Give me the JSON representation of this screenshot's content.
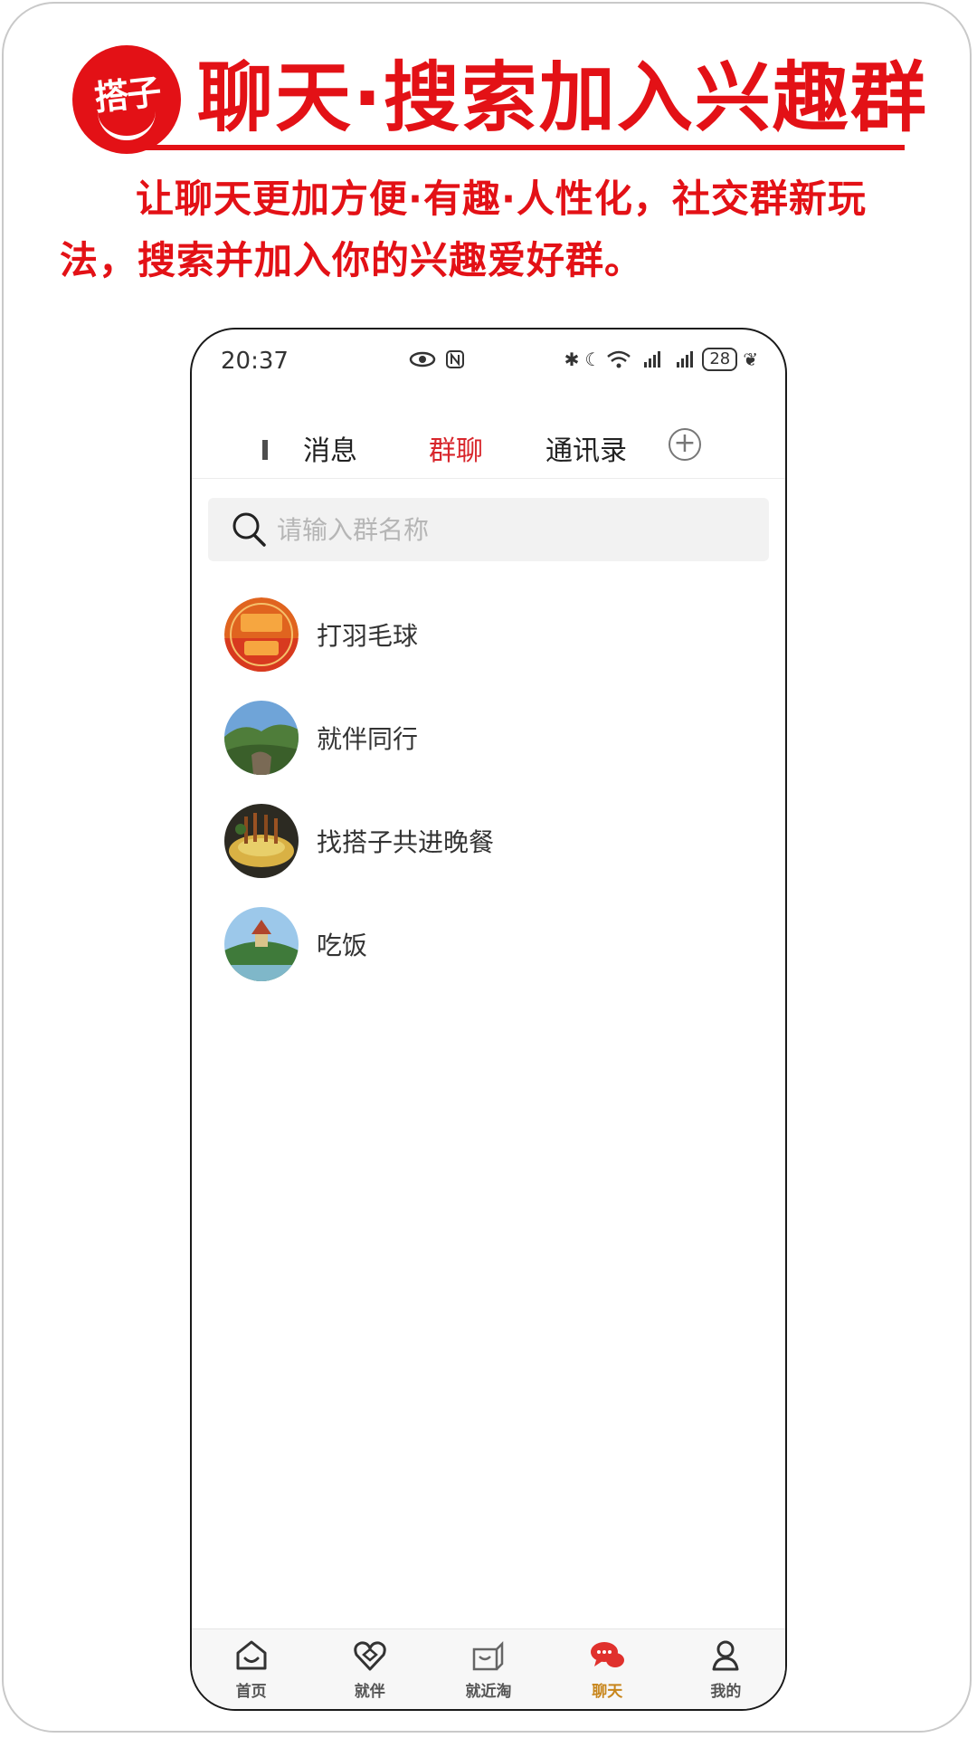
{
  "promo": {
    "logo_text": "搭子",
    "headline": "聊天·搜索加入兴趣群",
    "description": "让聊天更加方便·有趣·人性化，社交群新玩法，搜索并加入你的兴趣爱好群。"
  },
  "statusbar": {
    "time": "20:37",
    "battery": "28"
  },
  "tabs": [
    {
      "label": "消息"
    },
    {
      "label": "群聊"
    },
    {
      "label": "通讯录"
    }
  ],
  "active_tab": "群聊",
  "search": {
    "placeholder": "请输入群名称",
    "value": ""
  },
  "groups": [
    {
      "name": "打羽毛球",
      "avatar": "logo-jiubao-avatar"
    },
    {
      "name": "就伴同行",
      "avatar": "landscape-avatar"
    },
    {
      "name": "找搭子共进晚餐",
      "avatar": "food-avatar"
    },
    {
      "name": "吃饭",
      "avatar": "pavilion-avatar"
    }
  ],
  "bottom_nav": [
    {
      "label": "首页",
      "icon": "home-icon"
    },
    {
      "label": "就伴",
      "icon": "heart-icon"
    },
    {
      "label": "就近淘",
      "icon": "shop-icon"
    },
    {
      "label": "聊天",
      "icon": "chat-icon"
    },
    {
      "label": "我的",
      "icon": "profile-icon"
    }
  ],
  "colors": {
    "brand_red": "#e31116",
    "active_tab": "#d8262c",
    "nav_active": "#c8861c"
  }
}
